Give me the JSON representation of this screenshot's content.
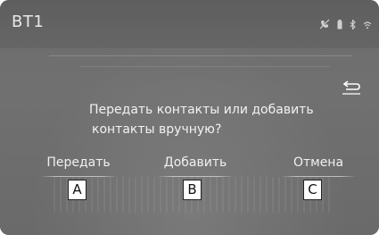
{
  "header": {
    "title": "BT1",
    "status_icons": [
      "no-phone-icon",
      "battery-icon",
      "bluetooth-icon",
      "wifi-icon"
    ]
  },
  "dialog": {
    "prompt_line1": "Передать контакты или добавить",
    "prompt_line2": "контакты вручную?",
    "buttons": {
      "transfer": "Передать",
      "add": "Добавить",
      "cancel": "Отмена"
    }
  },
  "callouts": {
    "a": "A",
    "b": "B",
    "c": "C"
  },
  "colors": {
    "screen_bg": "#6d6d6d",
    "text": "#f0f0f0"
  }
}
